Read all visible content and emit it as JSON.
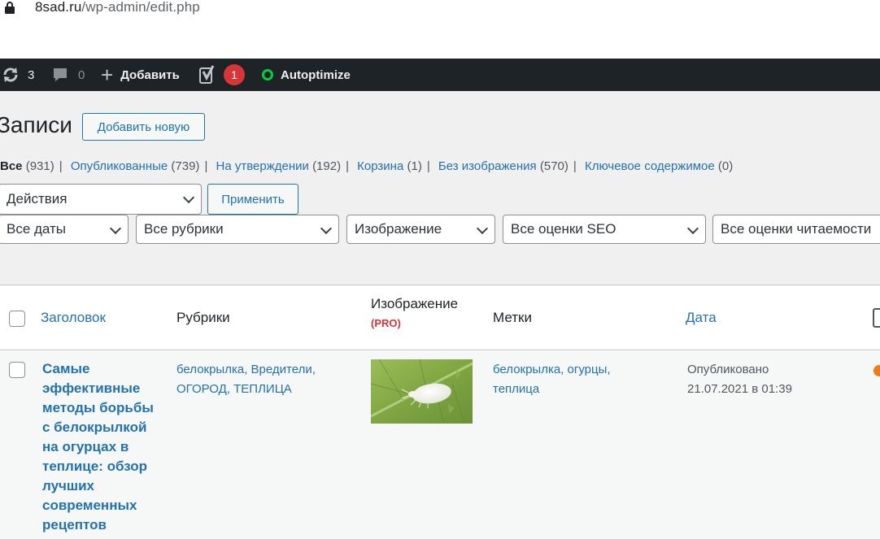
{
  "browser": {
    "url_host": "8sad.ru",
    "url_path": "/wp-admin/edit.php"
  },
  "adminbar": {
    "updates_count": "3",
    "comments_count": "0",
    "add_label": "Добавить",
    "yoast_badge": "1",
    "autoptimize_label": "Autoptimize"
  },
  "page": {
    "title": "Записи",
    "add_new": "Добавить новую"
  },
  "views": {
    "all": {
      "label": "Все",
      "count": "(931)"
    },
    "published": {
      "label": "Опубликованные",
      "count": "(739)"
    },
    "pending": {
      "label": "На утверждении",
      "count": "(192)"
    },
    "trash": {
      "label": "Корзина",
      "count": "(1)"
    },
    "no_image": {
      "label": "Без изображения",
      "count": "(570)"
    },
    "cornerstone": {
      "label": "Ключевое содержимое",
      "count": "(0)"
    }
  },
  "bulk": {
    "actions": "Действия",
    "apply": "Применить"
  },
  "filters": {
    "dates": "Все даты",
    "categories": "Все рубрики",
    "image": "Изображение",
    "seo": "Все оценки SEO",
    "readability": "Все оценки читаемости"
  },
  "table": {
    "headers": {
      "title": "Заголовок",
      "categories": "Рубрики",
      "image": "Изображение",
      "image_pro": "(PRO)",
      "tags": "Метки",
      "date": "Дата"
    },
    "rows": [
      {
        "title": "Самые эффективные методы борьбы с белокрылкой на огурцах в теплице: обзор лучших современных рецептов",
        "categories": "белокрылка, Вредители, ОГОРОД, ТЕПЛИЦА",
        "tags": "белокрылка, огурцы, теплица",
        "status": "Опубликовано",
        "date": "21.07.2021 в 01:39"
      }
    ]
  },
  "colors": {
    "accent": "#2271b1",
    "adminbar": "#1d2327",
    "badge": "#d63638",
    "seo_status": "#ee7c1b"
  }
}
